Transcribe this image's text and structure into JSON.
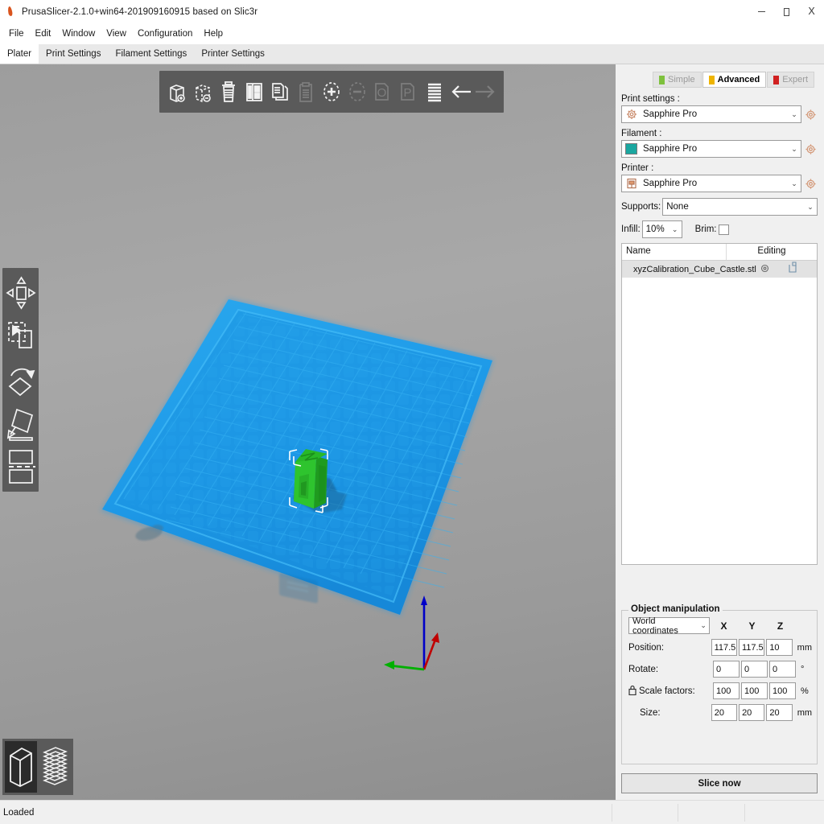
{
  "window": {
    "title": "PrusaSlicer-2.1.0+win64-201909160915 based on Slic3r",
    "app_icon": "prusa-flame-icon",
    "minimize_label": "–",
    "maximize_label": "□",
    "close_label": "X"
  },
  "menubar": {
    "items": [
      {
        "label": "File"
      },
      {
        "label": "Edit"
      },
      {
        "label": "Window"
      },
      {
        "label": "View"
      },
      {
        "label": "Configuration"
      },
      {
        "label": "Help"
      }
    ]
  },
  "tabs": [
    {
      "label": "Plater",
      "active": true
    },
    {
      "label": "Print Settings",
      "active": false
    },
    {
      "label": "Filament Settings",
      "active": false
    },
    {
      "label": "Printer Settings",
      "active": false
    }
  ],
  "top_toolbar": {
    "buttons": [
      {
        "name": "add-object",
        "enabled": true
      },
      {
        "name": "delete-object",
        "enabled": true
      },
      {
        "name": "delete-all",
        "enabled": true
      },
      {
        "name": "arrange",
        "enabled": true
      },
      {
        "name": "copy",
        "enabled": true
      },
      {
        "name": "paste",
        "enabled": false
      },
      {
        "name": "add-instance",
        "enabled": true
      },
      {
        "name": "remove-instance",
        "enabled": false
      },
      {
        "name": "split-to-objects",
        "enabled": false
      },
      {
        "name": "split-to-parts",
        "enabled": false
      },
      {
        "name": "layers-editing",
        "enabled": true
      },
      {
        "name": "undo",
        "enabled": true
      },
      {
        "name": "redo",
        "enabled": false
      }
    ]
  },
  "left_toolbar": {
    "buttons": [
      {
        "name": "move-gizmo"
      },
      {
        "name": "scale-gizmo"
      },
      {
        "name": "rotate-gizmo"
      },
      {
        "name": "place-on-face-gizmo"
      },
      {
        "name": "cut-gizmo"
      }
    ]
  },
  "view_mode": {
    "buttons": [
      {
        "name": "editor-view",
        "active": true
      },
      {
        "name": "preview-view",
        "active": false
      }
    ]
  },
  "modes": [
    {
      "label": "Simple",
      "color": "#7ec13d",
      "active": false
    },
    {
      "label": "Advanced",
      "color": "#eeb400",
      "active": true
    },
    {
      "label": "Expert",
      "color": "#d02020",
      "active": false
    }
  ],
  "presets": {
    "print_settings_label": "Print settings :",
    "print_settings_value": "Sapphire Pro",
    "filament_label": "Filament :",
    "filament_value": "Sapphire Pro",
    "filament_color": "#1ba7a0",
    "printer_label": "Printer :",
    "printer_value": "Sapphire Pro",
    "arrow": "⌄"
  },
  "options": {
    "supports_label": "Supports:",
    "supports_value": "None",
    "infill_label": "Infill:",
    "infill_value": "10%",
    "brim_label": "Brim:",
    "brim_checked": false
  },
  "object_list": {
    "col_name": "Name",
    "col_editing": "Editing",
    "rows": [
      {
        "name": "xyzCalibration_Cube_Castle.stl",
        "settings_icon": "gear-small-icon",
        "editing_icon": "layers-small-icon"
      }
    ]
  },
  "object_manipulation": {
    "title": "Object manipulation",
    "coordinates": "World coordinates",
    "axes": [
      "X",
      "Y",
      "Z"
    ],
    "rows": [
      {
        "label": "Position:",
        "values": [
          "117.5",
          "117.5",
          "10"
        ],
        "unit": "mm",
        "lock": false,
        "indent": false
      },
      {
        "label": "Rotate:",
        "values": [
          "0",
          "0",
          "0"
        ],
        "unit": "°",
        "lock": false,
        "indent": false
      },
      {
        "label": "Scale factors:",
        "values": [
          "100",
          "100",
          "100"
        ],
        "unit": "%",
        "lock": true,
        "indent": false
      },
      {
        "label": "Size:",
        "values": [
          "20",
          "20",
          "20"
        ],
        "unit": "mm",
        "lock": false,
        "indent": true
      }
    ]
  },
  "slice_button": {
    "label": "Slice now"
  },
  "statusbar": {
    "text": "Loaded"
  },
  "scene": {
    "bed_color": "#1e9ae8",
    "model_color": "#23b523",
    "axis_x_color": "#00b000",
    "axis_y_color": "#c00000",
    "axis_z_color": "#0000c8",
    "background_color": "#9d9d9d"
  }
}
